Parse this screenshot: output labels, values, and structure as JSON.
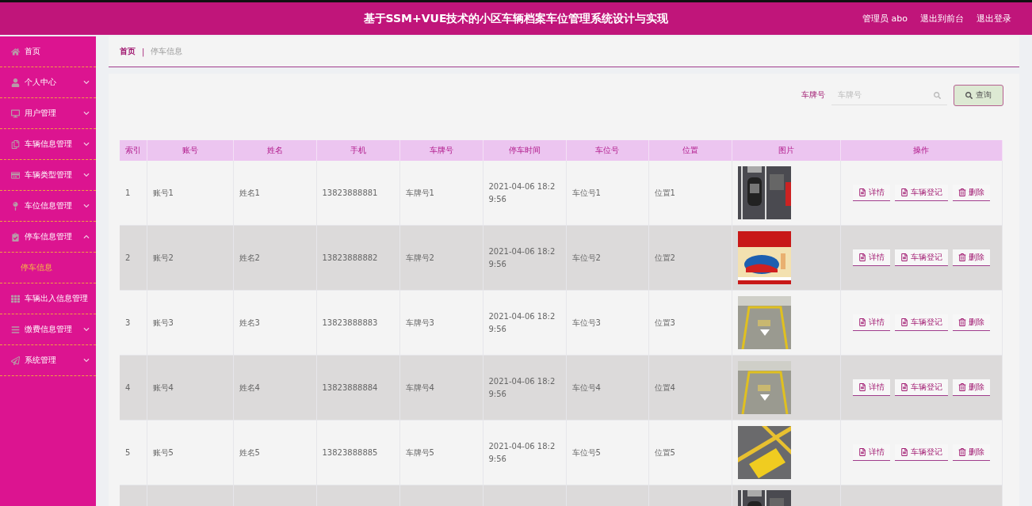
{
  "header": {
    "title": "基于SSM+VUE技术的小区车辆档案车位管理系统设计与实现",
    "links": [
      "管理员 abo",
      "退出到前台",
      "退出登录"
    ]
  },
  "sidebar": {
    "items": [
      {
        "label": "首页",
        "has_arrow": false
      },
      {
        "label": "个人中心",
        "expanded": false,
        "has_arrow": true
      },
      {
        "label": "用户管理",
        "expanded": false,
        "has_arrow": true
      },
      {
        "label": "车辆信息管理",
        "expanded": false,
        "has_arrow": true
      },
      {
        "label": "车辆类型管理",
        "expanded": false,
        "has_arrow": true
      },
      {
        "label": "车位信息管理",
        "expanded": false,
        "has_arrow": true
      },
      {
        "label": "停车信息管理",
        "expanded": true,
        "has_arrow": true,
        "children": [
          {
            "label": "停车信息",
            "selected": true
          }
        ]
      },
      {
        "label": "车辆出入信息管理",
        "has_arrow": false
      },
      {
        "label": "缴费信息管理",
        "expanded": false,
        "has_arrow": true
      },
      {
        "label": "系统管理",
        "expanded": false,
        "has_arrow": true
      }
    ]
  },
  "breadcrumb": {
    "items": [
      "首页",
      "停车信息"
    ],
    "separator": "|"
  },
  "search": {
    "label": "车牌号",
    "placeholder": "车牌号",
    "button": "查询"
  },
  "table": {
    "columns": [
      "索引",
      "账号",
      "姓名",
      "手机",
      "车牌号",
      "停车时间",
      "车位号",
      "位置",
      "图片",
      "操作"
    ],
    "rows": [
      {
        "cells": [
          "1",
          "账号1",
          "姓名1",
          "13823888881",
          "车牌号1",
          "2021-04-06 18:29:56",
          "车位号1",
          "位置1"
        ],
        "actions": [
          "详情",
          "车辆登记",
          "删除"
        ]
      },
      {
        "cells": [
          "2",
          "账号2",
          "姓名2",
          "13823888882",
          "车牌号2",
          "2021-04-06 18:29:56",
          "车位号2",
          "位置2"
        ],
        "actions": [
          "详情",
          "车辆登记",
          "删除"
        ]
      },
      {
        "cells": [
          "3",
          "账号3",
          "姓名3",
          "13823888883",
          "车牌号3",
          "2021-04-06 18:29:56",
          "车位号3",
          "位置3"
        ],
        "actions": [
          "详情",
          "车辆登记",
          "删除"
        ]
      },
      {
        "cells": [
          "4",
          "账号4",
          "姓名4",
          "13823888884",
          "车牌号4",
          "2021-04-06 18:29:56",
          "车位号4",
          "位置4"
        ],
        "actions": [
          "详情",
          "车辆登记",
          "删除"
        ]
      },
      {
        "cells": [
          "5",
          "账号5",
          "姓名5",
          "13823888885",
          "车牌号5",
          "2021-04-06 18:29:56",
          "车位号5",
          "位置5"
        ],
        "actions": [
          "详情",
          "车辆登记",
          "删除"
        ]
      }
    ]
  }
}
